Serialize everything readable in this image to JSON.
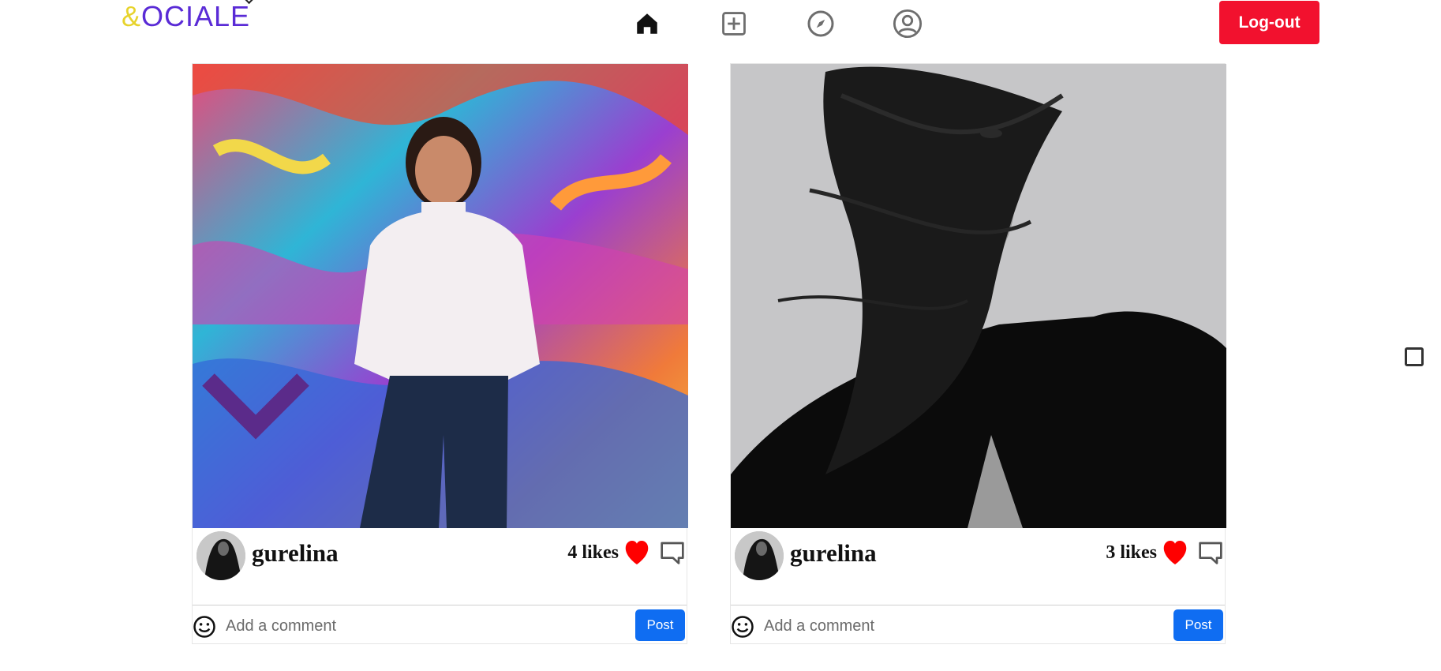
{
  "brand": {
    "amp": "&",
    "name": "OCIALE"
  },
  "nav": {
    "items": [
      {
        "icon": "home-icon",
        "active": true
      },
      {
        "icon": "add-post-icon",
        "active": false
      },
      {
        "icon": "compass-icon",
        "active": false
      },
      {
        "icon": "profile-icon",
        "active": false
      }
    ]
  },
  "header": {
    "logout_label": "Log-out"
  },
  "colors": {
    "accent": "#f2112e",
    "brand_yellow": "#e7d32c",
    "brand_purple": "#5a2bd6",
    "post_button": "#0f6df2",
    "heart": "#ff0000"
  },
  "posts": [
    {
      "username": "gurelina",
      "likes": "4 likes",
      "comment_placeholder": "Add a comment",
      "post_label": "Post",
      "image": "woman-graffiti-wall-photo"
    },
    {
      "username": "gurelina",
      "likes": "3 likes",
      "comment_placeholder": "Add a comment",
      "post_label": "Post",
      "image": "woman-black-white-hair-photo"
    }
  ]
}
